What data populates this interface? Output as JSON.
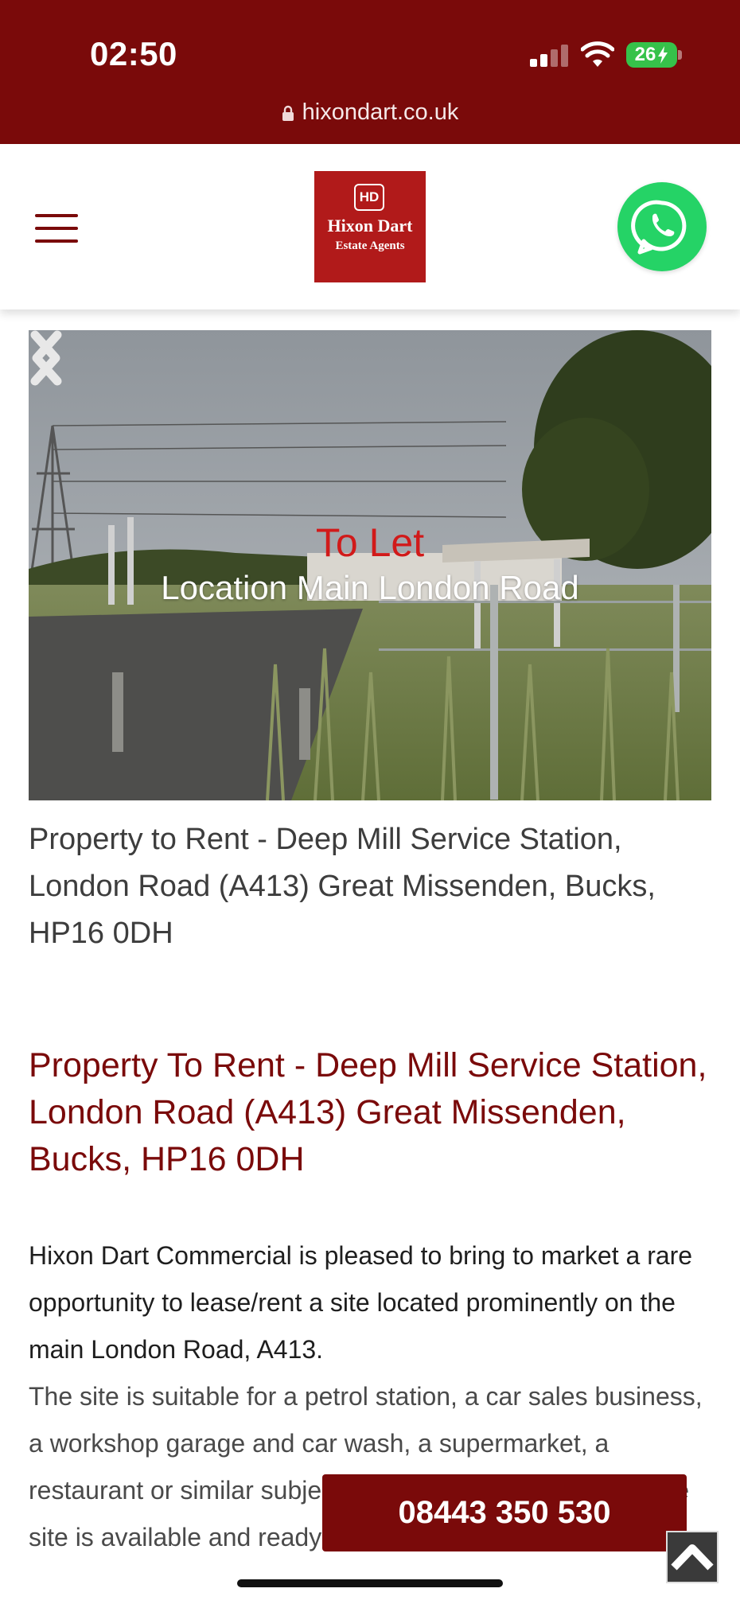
{
  "status_bar": {
    "time": "02:50",
    "battery": "26"
  },
  "browser": {
    "url": "hixondart.co.uk"
  },
  "header": {
    "logo_initials": "HD",
    "logo_name": "Hixon Dart",
    "logo_subtitle": "Estate Agents",
    "icons": [
      "menu-icon",
      "whatsapp-icon"
    ]
  },
  "hero": {
    "tag": "To Let",
    "location": "Location Main London Road",
    "icons": [
      "chevron-left-icon",
      "chevron-right-icon"
    ]
  },
  "listing": {
    "subtitle": "Property to Rent - Deep Mill Service Station, London Road (A413) Great Missenden, Bucks, HP16 0DH",
    "heading": "Property To Rent - Deep Mill Service Station, London Road (A413) Great Missenden, Bucks, HP16 0DH",
    "paragraph_1": "Hixon Dart Commercial is pleased to bring to market a rare opportunity to lease/rent a site located prominently on the main London Road, A413.",
    "paragraph_2": "The site is suitable for a petrol station, a car sales business, a workshop garage and car wash, a supermarket, a restaurant or similar subject to the necessary consent. The site is available and ready for business."
  },
  "actions": {
    "phone": "08443 350 530",
    "back_to_top_icon": "chevron-up-icon"
  },
  "colors": {
    "brand": "#7a0a0a",
    "logo": "#b11a1a",
    "whatsapp": "#25d366",
    "tag": "#d11a1a"
  }
}
